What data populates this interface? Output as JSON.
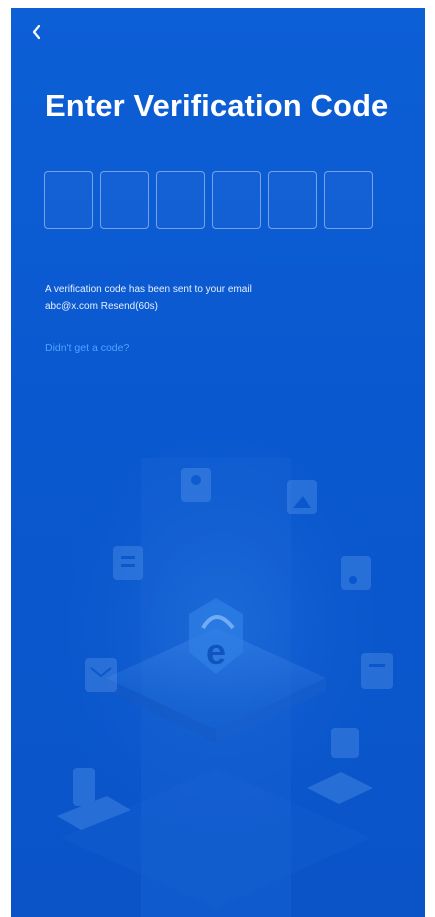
{
  "header": {
    "back_icon": "chevron-left-icon",
    "title": "Enter Verification Code"
  },
  "code": {
    "length": 6,
    "digits": [
      "",
      "",
      "",
      "",
      "",
      ""
    ]
  },
  "info": {
    "message": "A verification code has been sent to your email",
    "email": "abc@x.com",
    "resend_label": "Resend(60s)"
  },
  "help": {
    "link": "Didn't get a code?"
  },
  "illustration": {
    "logo_letter": "e",
    "icons": [
      "user-icon",
      "image-icon",
      "document-icon",
      "music-icon",
      "mail-icon",
      "file-icon",
      "phone-icon",
      "laptop-icon",
      "cloud-icon",
      "folder-icon"
    ]
  },
  "colors": {
    "background": "#0d5fd6",
    "link": "#4ea3ff",
    "text": "#ffffff"
  }
}
